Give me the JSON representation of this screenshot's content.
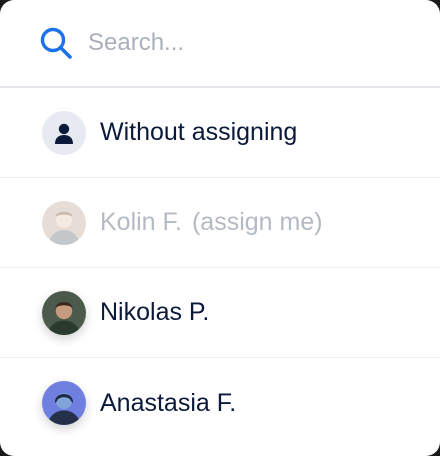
{
  "search": {
    "placeholder": "Search..."
  },
  "assignees": [
    {
      "name": "Without assigning",
      "suffix": "",
      "avatar": "person-placeholder-icon",
      "disabled": false
    },
    {
      "name": "Kolin F.",
      "suffix": "(assign me)",
      "avatar": "user-photo",
      "disabled": true
    },
    {
      "name": "Nikolas P.",
      "suffix": "",
      "avatar": "user-photo",
      "disabled": false
    },
    {
      "name": "Anastasia F.",
      "suffix": "",
      "avatar": "user-photo",
      "disabled": false
    }
  ],
  "colors": {
    "accent": "#1a73e8",
    "text": "#0b1a3b",
    "muted": "#b4bac4",
    "divider": "#e2e5ea"
  }
}
